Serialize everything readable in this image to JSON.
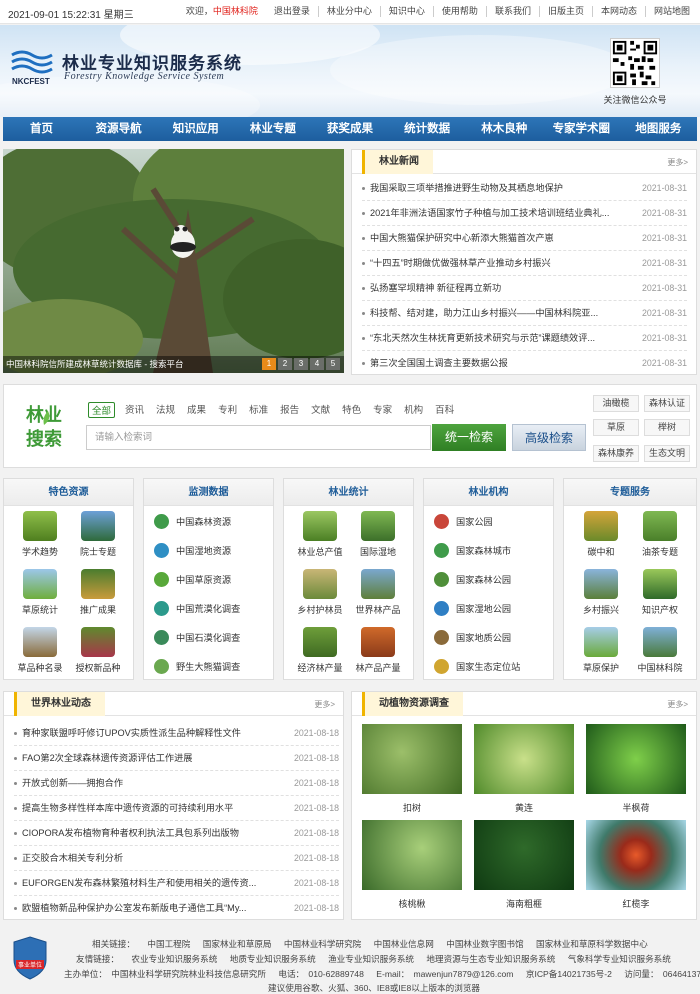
{
  "topbar": {
    "datetime": "2021-09-01 15:22:31 星期三",
    "links": [
      "欢迎，",
      "中国林科院",
      "退出登录",
      "林业分中心",
      "知识中心",
      "使用帮助",
      "联系我们",
      "旧版主页",
      "本网动态",
      "网站地图"
    ]
  },
  "header": {
    "logo_text": "NKCFEST",
    "title": "林业专业知识服务系统",
    "subtitle": "Forestry Knowledge Service System",
    "qr_caption": "关注微信公众号"
  },
  "nav": [
    "首页",
    "资源导航",
    "知识应用",
    "林业专题",
    "获奖成果",
    "统计数据",
    "林木良种",
    "专家学术圈",
    "地图服务"
  ],
  "slider": {
    "caption": "中国林科院信所建成林草统计数据库 - 搜索平台",
    "pages": [
      "1",
      "2",
      "3",
      "4",
      "5"
    ],
    "active_page": "1"
  },
  "forestry_news": {
    "title": "林业新闻",
    "more": "更多>",
    "items": [
      {
        "text": "我国采取三项举措推进野生动物及其栖息地保护",
        "date": "2021-08-31"
      },
      {
        "text": "2021年非洲法语国家竹子种植与加工技术培训班结业典礼...",
        "date": "2021-08-31"
      },
      {
        "text": "中国大熊猫保护研究中心新添大熊猫首次产崽",
        "date": "2021-08-31"
      },
      {
        "text": "“十四五”时期做优做强林草产业推动乡村振兴",
        "date": "2021-08-31"
      },
      {
        "text": "弘扬塞罕坝精神 新征程再立新功",
        "date": "2021-08-31"
      },
      {
        "text": "科技帮、结对建，助力江山乡村振兴——中国林科院亚...",
        "date": "2021-08-31"
      },
      {
        "text": "“东北天然次生林抚育更新技术研究与示范”课题绩效评...",
        "date": "2021-08-31"
      },
      {
        "text": "第三次全国国土调查主要数据公报",
        "date": "2021-08-31"
      }
    ]
  },
  "search": {
    "logo_line1": "林业",
    "logo_line2": "搜索",
    "tabs": [
      "全部",
      "资讯",
      "法规",
      "成果",
      "专利",
      "标准",
      "报告",
      "文献",
      "特色",
      "专家",
      "机构",
      "百科"
    ],
    "active_tab": "全部",
    "placeholder": "请输入检索词",
    "btn_unified": "统一检索",
    "btn_advanced": "高级检索",
    "keywords": [
      "油橄榄",
      "森林认证",
      "草原",
      "榉树",
      "森林康养",
      "生态文明"
    ]
  },
  "columns": {
    "featured": {
      "title": "特色资源",
      "items": [
        "学术趋势",
        "院士专题",
        "草原统计",
        "推广成果",
        "草品种名录",
        "授权新品种"
      ]
    },
    "monitoring": {
      "title": "监测数据",
      "items": [
        "中国森林资源",
        "中国湿地资源",
        "中国草原资源",
        "中国荒漠化调查",
        "中国石漠化调查",
        "野生大熊猫调查"
      ]
    },
    "statistics": {
      "title": "林业统计",
      "items": [
        "林业总产值",
        "国际湿地",
        "乡村护林员",
        "世界林产品",
        "经济林产量",
        "林产品产量"
      ]
    },
    "institutions": {
      "title": "林业机构",
      "items": [
        "国家公园",
        "国家森林城市",
        "国家森林公园",
        "国家湿地公园",
        "国家地质公园",
        "国家生态定位站"
      ]
    },
    "topics": {
      "title": "专题服务",
      "items": [
        "碳中和",
        "油茶专题",
        "乡村振兴",
        "知识产权",
        "草原保护",
        "中国林科院"
      ]
    }
  },
  "world_news": {
    "title": "世界林业动态",
    "more": "更多>",
    "items": [
      {
        "text": "育种家联盟呼吁修订UPOV实质性派生品种解释性文件",
        "date": "2021-08-18"
      },
      {
        "text": "FAO第2次全球森林遗传资源评估工作进展",
        "date": "2021-08-18"
      },
      {
        "text": "开放式创新——拥抱合作",
        "date": "2021-08-18"
      },
      {
        "text": "提高生物多样性样本库中遗传资源的可持续利用水平",
        "date": "2021-08-18"
      },
      {
        "text": "CIOPORA发布植物育种者权利执法工具包系列出版物",
        "date": "2021-08-18"
      },
      {
        "text": "正交胶合木相关专利分析",
        "date": "2021-08-18"
      },
      {
        "text": "EUFORGEN发布森林繁殖材料生产和使用相关的遗传资...",
        "date": "2021-08-18"
      },
      {
        "text": "欧盟植物新品种保护办公室发布新版电子通信工具“My...",
        "date": "2021-08-18"
      }
    ]
  },
  "flora_fauna": {
    "title": "动植物资源调查",
    "more": "更多>",
    "items": [
      "扣树",
      "黄连",
      "半枫荷",
      "核桃楸",
      "海南粗榧",
      "红榄李"
    ]
  },
  "footer": {
    "badge_text": "事业单位",
    "related_label": "相关链接：",
    "related": [
      "中国工程院",
      "国家林业和草原局",
      "中国林业科学研究院",
      "中国林业信息网",
      "中国林业数字图书馆",
      "国家林业和草原科学数据中心"
    ],
    "friend_label": "友情链接：",
    "friends": [
      "农业专业知识服务系统",
      "地质专业知识服务系统",
      "渔业专业知识服务系统",
      "地理资源与生态专业知识服务系统",
      "气象科学专业知识服务系统"
    ],
    "host": "主办单位：　中国林业科学研究院林业科技信息研究所",
    "phone": "电话：　010-62889748",
    "email": "E-mail：　mawenjun7879@126.com",
    "icp": "京ICP备14021735号-2",
    "visits": "访问量：　06464137",
    "browser_note": "建议使用谷歌、火狐、360、IE8或IE8以上版本的浏览器"
  }
}
